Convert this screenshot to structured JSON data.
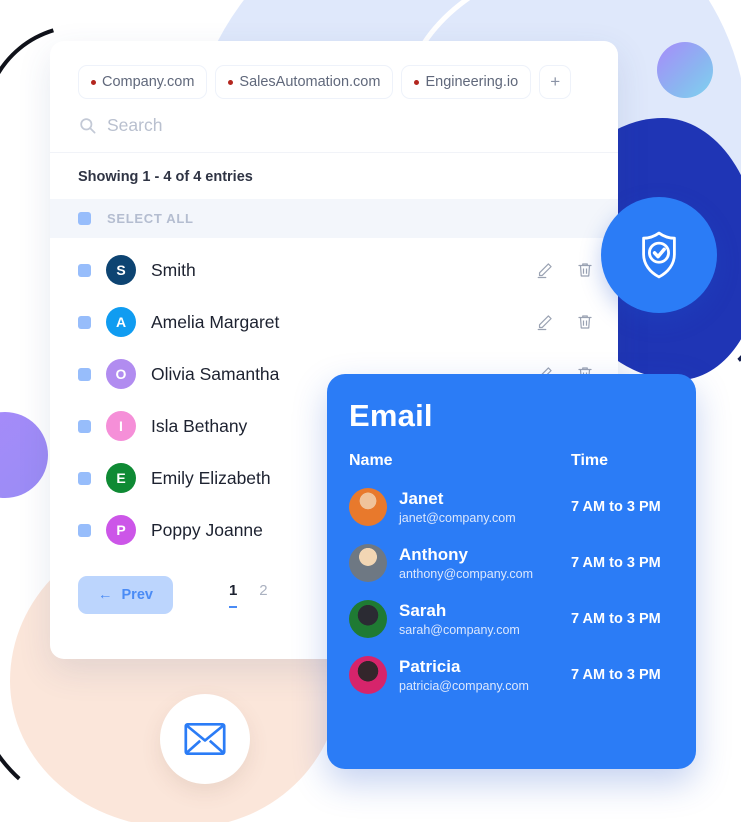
{
  "tabs": [
    {
      "label": "Company.com",
      "dot_color": "#b3261e"
    },
    {
      "label": "SalesAutomation.com",
      "dot_color": "#b3261e"
    },
    {
      "label": "Engineering.io",
      "dot_color": "#b3261e"
    }
  ],
  "add_tab_label": "+",
  "search": {
    "placeholder": "Search",
    "value": "",
    "icon": "search-icon"
  },
  "showing_text": "Showing 1 - 4 of 4 entries",
  "select_all_label": "SELECT ALL",
  "contacts": [
    {
      "initial": "S",
      "name": "Smith",
      "color": "#0d4472"
    },
    {
      "initial": "A",
      "name": "Amelia Margaret",
      "color": "#109cf1"
    },
    {
      "initial": "O",
      "name": "Olivia Samantha",
      "color": "#b18cf0"
    },
    {
      "initial": "I",
      "name": "Isla Bethany",
      "color": "#f58fd8"
    },
    {
      "initial": "E",
      "name": "Emily Elizabeth",
      "color": "#0f8a34"
    },
    {
      "initial": "P",
      "name": "Poppy Joanne",
      "color": "#c койд"
    }
  ],
  "row_actions": {
    "edit_icon": "pencil-icon",
    "delete_icon": "trash-icon"
  },
  "pagination": {
    "prev_label": "Prev",
    "prev_arrow": "←",
    "pages": [
      "1",
      "2"
    ],
    "active_page": "1"
  },
  "email_panel": {
    "title": "Email",
    "columns": {
      "name": "Name",
      "time": "Time"
    },
    "rows": [
      {
        "name": "Janet",
        "email": "janet@company.com",
        "time": "7 AM to 3 PM",
        "avatar_color": "#8fa8bd"
      },
      {
        "name": "Anthony",
        "email": "anthony@company.com",
        "time": "7 AM to 3 PM",
        "avatar_color": "#c9c6a8"
      },
      {
        "name": "Sarah",
        "email": "sarah@company.com",
        "time": "7 AM to 3 PM",
        "avatar_color": "#1f7a33"
      },
      {
        "name": "Patricia",
        "email": "patricia@company.com",
        "time": "7 AM to 3 PM",
        "avatar_color": "#d6246b"
      }
    ]
  },
  "badges": {
    "shield": {
      "icon": "shield-check-icon",
      "color": "#2b7cf6"
    },
    "mail": {
      "icon": "envelope-icon",
      "color": "#2b7cf6"
    }
  },
  "colors": {
    "accent_blue": "#2b7cf6",
    "checkbox_blue": "#97bdfb",
    "prev_button_bg": "#bcd5fd",
    "select_all_bg": "#f3f6fb",
    "peach_blob": "#fbe6da",
    "lightblue_blob": "#dfe8fb",
    "navy_blob": "#1f35b5"
  }
}
